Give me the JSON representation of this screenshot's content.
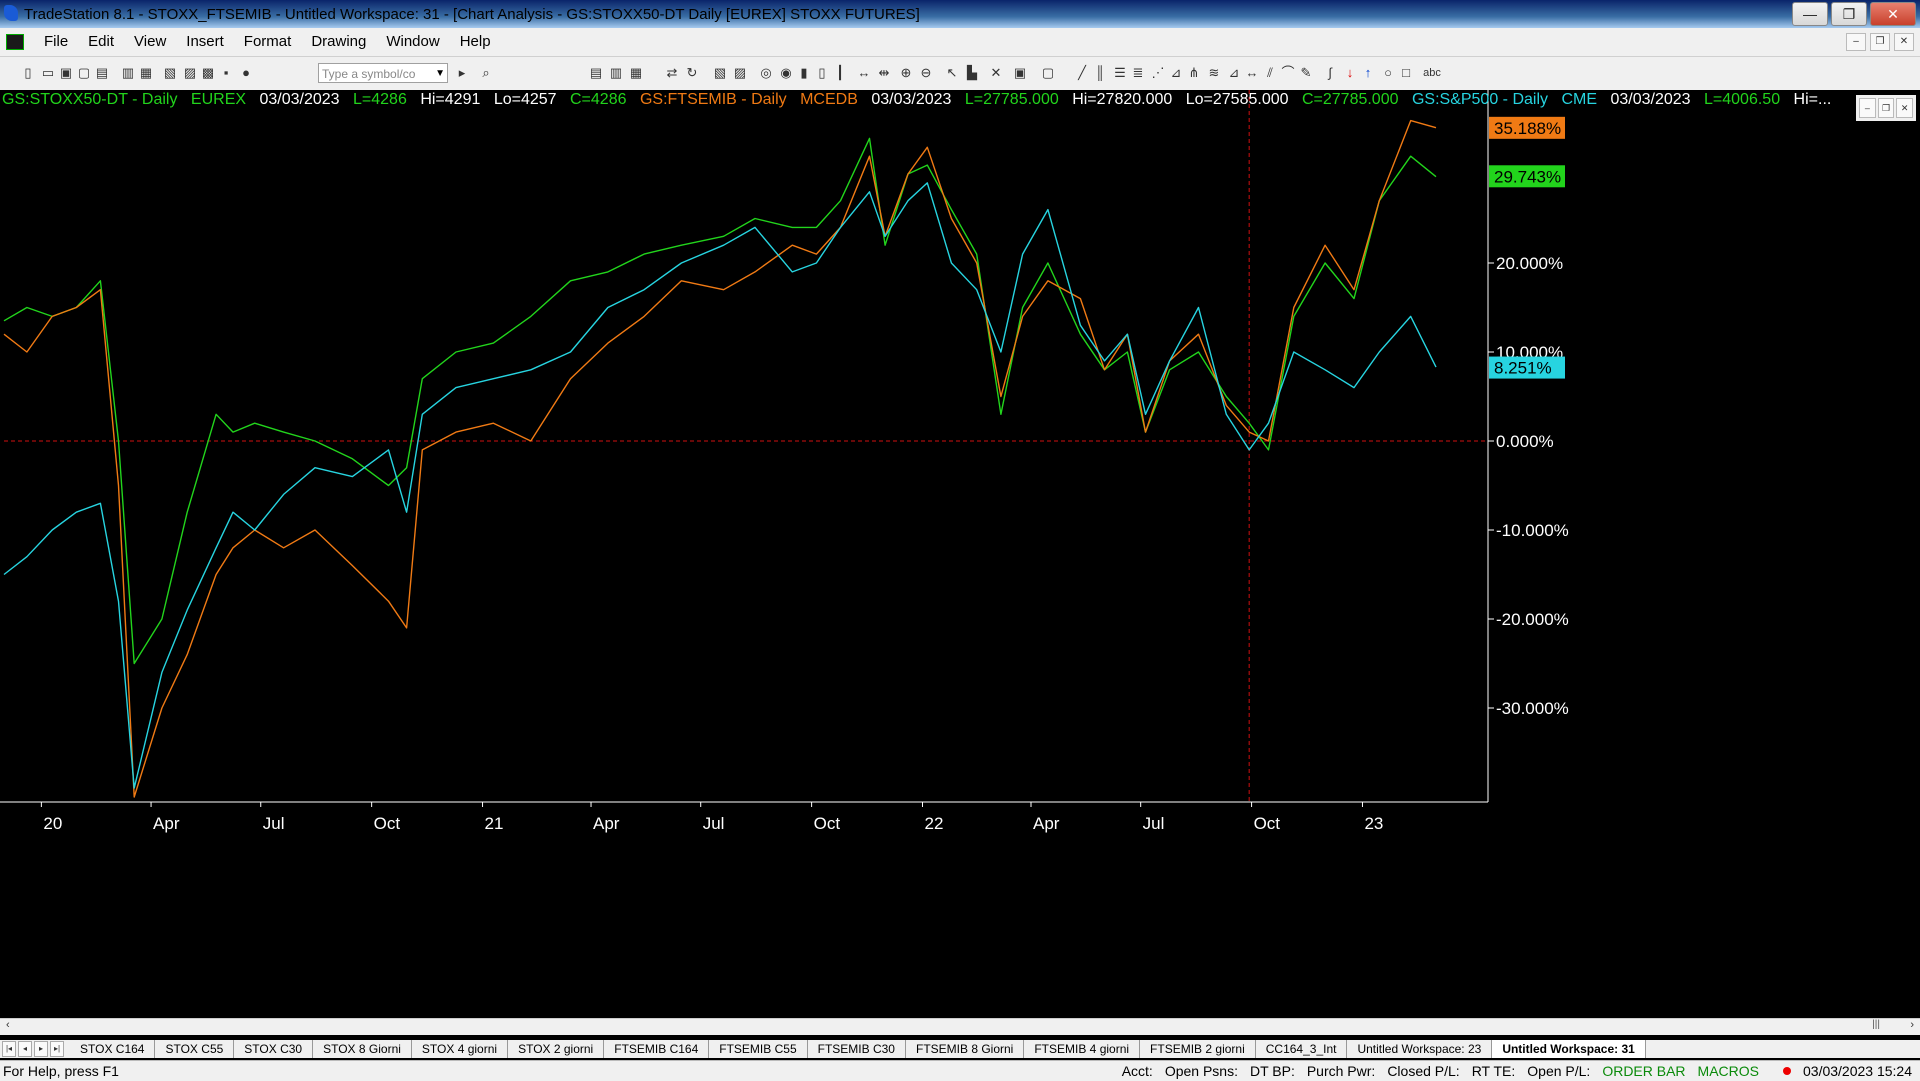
{
  "window": {
    "title": "TradeStation 8.1 - STOXX_FTSEMIB - Untitled Workspace:  31 - [Chart Analysis - GS:STOXX50-DT  Daily  [EUREX] STOXX FUTURES]",
    "minimize": "—",
    "maximize": "❐",
    "close": "✕"
  },
  "menu": [
    "File",
    "Edit",
    "View",
    "Insert",
    "Format",
    "Drawing",
    "Window",
    "Help"
  ],
  "mdi_controls": [
    "–",
    "❐",
    "✕"
  ],
  "toolbar": {
    "symbol_placeholder": "Type a symbol/co",
    "text_tool": "abc"
  },
  "info_line": {
    "stoxx": {
      "symbol": "GS:STOXX50-DT - Daily",
      "exchange": "EUREX",
      "date": "03/03/2023",
      "last": "L=4286",
      "hi": "Hi=4291",
      "lo": "Lo=4257",
      "close": "C=4286"
    },
    "ftse": {
      "symbol": "GS:FTSEMIB - Daily",
      "exchange": "MCEDB",
      "date": "03/03/2023",
      "last": "L=27785.000",
      "hi": "Hi=27820.000",
      "lo": "Lo=27585.000",
      "close": "C=27785.000"
    },
    "sp": {
      "symbol": "GS:S&P500 - Daily",
      "exchange": "CME",
      "date": "03/03/2023",
      "last": "L=4006.50",
      "hi": "Hi=..."
    }
  },
  "colors": {
    "stoxx": "#22d41c",
    "ftse": "#f07a14",
    "sp": "#27d4e0",
    "zero_line": "#d01010",
    "axis_text": "#ffffff"
  },
  "chart_data": {
    "type": "line",
    "yaxis_unit": "% change",
    "ylim": [
      -40,
      40
    ],
    "y_ticks": [
      "20.000%",
      "10.000%",
      "0.000%",
      "-10.000%",
      "-20.000%",
      "-30.000%"
    ],
    "x_ticks": [
      "20",
      "Apr",
      "Jul",
      "Oct",
      "21",
      "Apr",
      "Jul",
      "Oct",
      "22",
      "Apr",
      "Jul",
      "Oct",
      "23"
    ],
    "x_tick_dates": [
      "2020-01",
      "2020-04",
      "2020-07",
      "2020-10",
      "2021-01",
      "2021-04",
      "2021-07",
      "2021-10",
      "2022-01",
      "2022-04",
      "2022-07",
      "2022-10",
      "2023-01"
    ],
    "reference_line_y": 0,
    "last_value_labels": [
      {
        "series": "ftse",
        "label": "35.188%",
        "value": 35.188
      },
      {
        "series": "stoxx",
        "label": "29.743%",
        "value": 29.743
      },
      {
        "series": "sp",
        "label": "8.251%",
        "value": 8.251
      }
    ],
    "series": [
      {
        "name": "GS:STOXX50-DT",
        "key": "stoxx",
        "x": [
          "2019-12-01",
          "2019-12-20",
          "2020-01-10",
          "2020-01-30",
          "2020-02-19",
          "2020-03-05",
          "2020-03-18",
          "2020-04-10",
          "2020-05-01",
          "2020-05-25",
          "2020-06-08",
          "2020-06-26",
          "2020-07-20",
          "2020-08-15",
          "2020-09-15",
          "2020-10-15",
          "2020-10-30",
          "2020-11-12",
          "2020-12-10",
          "2021-01-10",
          "2021-02-10",
          "2021-03-15",
          "2021-04-15",
          "2021-05-15",
          "2021-06-15",
          "2021-07-20",
          "2021-08-15",
          "2021-09-15",
          "2021-10-05",
          "2021-10-25",
          "2021-11-18",
          "2021-12-01",
          "2021-12-20",
          "2022-01-05",
          "2022-01-25",
          "2022-02-15",
          "2022-03-07",
          "2022-03-25",
          "2022-04-15",
          "2022-05-12",
          "2022-06-01",
          "2022-06-20",
          "2022-07-05",
          "2022-07-25",
          "2022-08-18",
          "2022-09-10",
          "2022-09-29",
          "2022-10-15",
          "2022-11-05",
          "2022-12-01",
          "2022-12-25",
          "2023-01-15",
          "2023-02-10",
          "2023-03-03"
        ],
        "y": [
          13.5,
          15,
          14,
          15,
          18,
          0,
          -25,
          -20,
          -8,
          3,
          1,
          2,
          1,
          0,
          -2,
          -5,
          -3,
          7,
          10,
          11,
          14,
          18,
          19,
          21,
          22,
          23,
          25,
          24,
          24,
          27,
          34,
          22,
          30,
          31,
          26,
          21,
          3,
          15,
          20,
          12,
          8,
          10,
          1,
          8,
          10,
          5,
          2,
          -1,
          14,
          20,
          16,
          27,
          32,
          29.7
        ]
      },
      {
        "name": "GS:FTSEMIB",
        "key": "ftse",
        "x": [
          "2019-12-01",
          "2019-12-20",
          "2020-01-10",
          "2020-01-30",
          "2020-02-19",
          "2020-03-05",
          "2020-03-18",
          "2020-04-10",
          "2020-05-01",
          "2020-05-25",
          "2020-06-08",
          "2020-06-26",
          "2020-07-20",
          "2020-08-15",
          "2020-09-15",
          "2020-10-15",
          "2020-10-30",
          "2020-11-12",
          "2020-12-10",
          "2021-01-10",
          "2021-02-10",
          "2021-03-15",
          "2021-04-15",
          "2021-05-15",
          "2021-06-15",
          "2021-07-20",
          "2021-08-15",
          "2021-09-15",
          "2021-10-05",
          "2021-10-25",
          "2021-11-18",
          "2021-12-01",
          "2021-12-20",
          "2022-01-05",
          "2022-01-25",
          "2022-02-15",
          "2022-03-07",
          "2022-03-25",
          "2022-04-15",
          "2022-05-12",
          "2022-06-01",
          "2022-06-20",
          "2022-07-05",
          "2022-07-25",
          "2022-08-18",
          "2022-09-10",
          "2022-09-29",
          "2022-10-15",
          "2022-11-05",
          "2022-12-01",
          "2022-12-25",
          "2023-01-15",
          "2023-02-10",
          "2023-03-03"
        ],
        "y": [
          12,
          10,
          14,
          15,
          17,
          -5,
          -40,
          -30,
          -24,
          -15,
          -12,
          -10,
          -12,
          -10,
          -14,
          -18,
          -21,
          -1,
          1,
          2,
          0,
          7,
          11,
          14,
          18,
          17,
          19,
          22,
          21,
          24,
          32,
          23,
          30,
          33,
          25,
          20,
          5,
          14,
          18,
          16,
          8,
          12,
          1,
          9,
          12,
          4,
          1,
          0,
          15,
          22,
          17,
          27,
          36,
          35.2
        ]
      },
      {
        "name": "GS:S&P500",
        "key": "sp",
        "x": [
          "2019-12-01",
          "2019-12-20",
          "2020-01-10",
          "2020-01-30",
          "2020-02-19",
          "2020-03-05",
          "2020-03-18",
          "2020-04-10",
          "2020-05-01",
          "2020-05-25",
          "2020-06-08",
          "2020-06-26",
          "2020-07-20",
          "2020-08-15",
          "2020-09-15",
          "2020-10-15",
          "2020-10-30",
          "2020-11-12",
          "2020-12-10",
          "2021-01-10",
          "2021-02-10",
          "2021-03-15",
          "2021-04-15",
          "2021-05-15",
          "2021-06-15",
          "2021-07-20",
          "2021-08-15",
          "2021-09-15",
          "2021-10-05",
          "2021-10-25",
          "2021-11-18",
          "2021-12-01",
          "2021-12-20",
          "2022-01-05",
          "2022-01-25",
          "2022-02-15",
          "2022-03-07",
          "2022-03-25",
          "2022-04-15",
          "2022-05-12",
          "2022-06-01",
          "2022-06-20",
          "2022-07-05",
          "2022-07-25",
          "2022-08-18",
          "2022-09-10",
          "2022-09-29",
          "2022-10-15",
          "2022-11-05",
          "2022-12-01",
          "2022-12-25",
          "2023-01-15",
          "2023-02-10",
          "2023-03-03"
        ],
        "y": [
          -15,
          -13,
          -10,
          -8,
          -7,
          -18,
          -39,
          -26,
          -19,
          -12,
          -8,
          -10,
          -6,
          -3,
          -4,
          -1,
          -8,
          3,
          6,
          7,
          8,
          10,
          15,
          17,
          20,
          22,
          24,
          19,
          20,
          24,
          28,
          23,
          27,
          29,
          20,
          17,
          10,
          21,
          26,
          13,
          9,
          12,
          3,
          9,
          15,
          3,
          -1,
          2,
          10,
          8,
          6,
          10,
          14,
          8.3
        ]
      }
    ]
  },
  "scroll": {
    "left": "‹",
    "right_grip": "|||",
    "right": "›"
  },
  "tab_nav": [
    "|◂",
    "◂",
    "▸",
    "▸|"
  ],
  "tabs": [
    {
      "label": "STOX C164",
      "active": false
    },
    {
      "label": "STOX C55",
      "active": false
    },
    {
      "label": "STOX  C30",
      "active": false
    },
    {
      "label": "STOX  8 Giorni",
      "active": false
    },
    {
      "label": "STOX 4 giorni",
      "active": false
    },
    {
      "label": "STOX  2 giorni",
      "active": false
    },
    {
      "label": "FTSEMIB C164",
      "active": false
    },
    {
      "label": "FTSEMIB C55",
      "active": false
    },
    {
      "label": "FTSEMIB C30",
      "active": false
    },
    {
      "label": "FTSEMIB  8 Giorni",
      "active": false
    },
    {
      "label": "FTSEMIB  4 giorni",
      "active": false
    },
    {
      "label": "FTSEMIB  2 giorni",
      "active": false
    },
    {
      "label": "CC164_3_Int",
      "active": false
    },
    {
      "label": "Untitled Workspace:  23",
      "active": false
    },
    {
      "label": "Untitled Workspace:  31",
      "active": true
    }
  ],
  "status": {
    "help": "For Help, press F1",
    "fields": [
      "Acct:",
      "Open Psns:",
      "DT BP:",
      "Purch Pwr:",
      "Closed P/L:",
      "RT TE:",
      "Open P/L:"
    ],
    "order_bar": "ORDER BAR",
    "macros": "MACROS",
    "datetime": "03/03/2023 15:24"
  }
}
